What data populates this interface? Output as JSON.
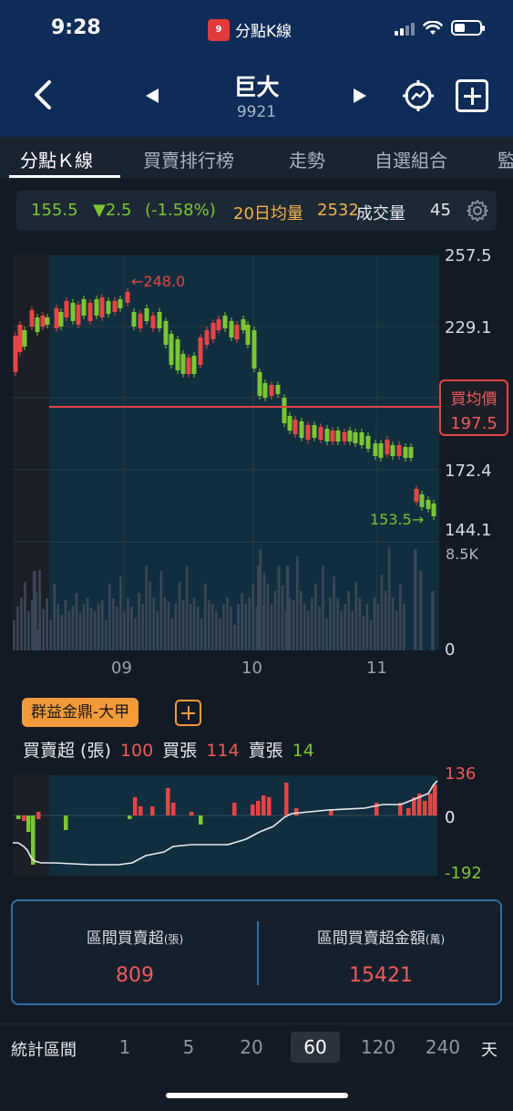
{
  "status": {
    "time": "9:28",
    "app_name": "分點K線"
  },
  "header": {
    "stock_name": "巨大",
    "stock_code": "9921"
  },
  "tabs": [
    {
      "label": "分點Ｋ線",
      "active": true
    },
    {
      "label": "買賣排行榜",
      "active": false
    },
    {
      "label": "走勢",
      "active": false
    },
    {
      "label": "自選組合",
      "active": false
    },
    {
      "label": "監",
      "active": false
    }
  ],
  "quote": {
    "price": "155.5",
    "change": "▼2.5",
    "change_pct": "(-1.58%)",
    "avg_label": "20日均量",
    "avg_value": "2532",
    "volume_label": "成交量",
    "volume_value": "45"
  },
  "chart_data": {
    "type": "candlestick",
    "y_ticks": [
      "257.5",
      "229.1",
      "172.4",
      "144.1"
    ],
    "ylim": [
      144.1,
      257.5
    ],
    "volume_ticks": [
      "8.5K",
      "0"
    ],
    "x_labels": [
      "09",
      "10",
      "11"
    ],
    "max_label": "248.0",
    "min_label": "153.5",
    "avg_price_label": "買均價",
    "avg_price_value": "197.5",
    "colors": {
      "up": "#e64545",
      "down": "#7cc633",
      "avg_line": "#e04545"
    }
  },
  "broker": {
    "name": "群益金鼎-大甲",
    "net_label": "買賣超 (張)",
    "net_value": "100",
    "buy_label": "買張",
    "buy_value": "114",
    "sell_label": "賣張",
    "sell_value": "14",
    "sub_ticks": [
      "136",
      "0",
      "-192"
    ]
  },
  "summary": {
    "net_title": "區間買賣超",
    "net_unit": "(張)",
    "net_value": "809",
    "amount_title": "區間買賣超金額",
    "amount_unit": "(萬)",
    "amount_value": "15421"
  },
  "period": {
    "label": "統計區間",
    "options": [
      "1",
      "5",
      "20",
      "60",
      "120",
      "240"
    ],
    "active": "60",
    "unit": "天"
  }
}
